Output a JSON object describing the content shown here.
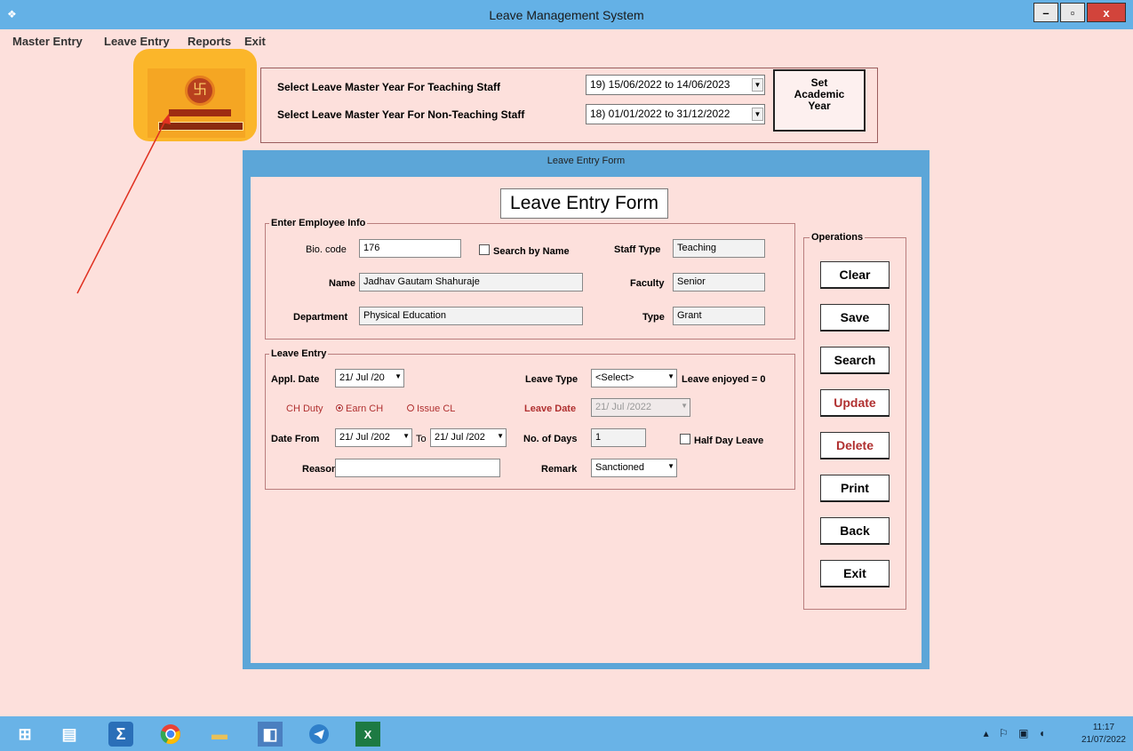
{
  "window": {
    "title": "Leave Management System"
  },
  "menu": [
    "Master Entry",
    "Leave Entry",
    "Reports",
    "Exit"
  ],
  "year": {
    "teaching_label": "Select Leave Master Year For Teaching Staff",
    "teaching_value": "19) 15/06/2022 to 14/06/2023",
    "nonteaching_label": "Select Leave Master Year For Non-Teaching Staff",
    "nonteaching_value": "18) 01/01/2022 to 31/12/2022",
    "set_button": [
      "Set",
      "Academic",
      "Year"
    ]
  },
  "dialog": {
    "title": "Leave Entry Form",
    "heading": "Leave Entry Form"
  },
  "employee": {
    "legend": "Enter Employee Info",
    "bio_label": "Bio. code",
    "bio_value": "176",
    "search_by_name": "Search by Name",
    "name_label": "Name",
    "name_value": "Jadhav Gautam Shahuraje",
    "dept_label": "Department",
    "dept_value": "Physical Education",
    "staff_type_label": "Staff Type",
    "staff_type_value": "Teaching",
    "faculty_label": "Faculty",
    "faculty_value": "Senior",
    "type_label": "Type",
    "type_value": "Grant"
  },
  "leave": {
    "legend": "Leave Entry",
    "appl_date_label": "Appl. Date",
    "appl_date_value": "21/ Jul /20",
    "ch_duty_label": "CH Duty",
    "earn_ch": "Earn CH",
    "issue_cl": "Issue CL",
    "date_from_label": "Date From",
    "date_from_value": "21/ Jul /202",
    "to_label": "To",
    "to_value": "21/ Jul /202",
    "reason_label": "Reason",
    "reason_value": "",
    "leave_type_label": "Leave Type",
    "leave_type_value": "<Select>",
    "leave_enjoyed": "Leave enjoyed = 0",
    "leave_date_label": "Leave Date",
    "leave_date_value": "21/ Jul /2022",
    "days_label": "No. of Days",
    "days_value": "1",
    "half_day": "Half Day Leave",
    "remark_label": "Remark",
    "remark_value": "Sanctioned"
  },
  "operations": {
    "legend": "Operations",
    "buttons": [
      "Clear",
      "Save",
      "Search",
      "Update",
      "Delete",
      "Print",
      "Back",
      "Exit"
    ]
  },
  "taskbar": {
    "time": "11:17",
    "date": "21/07/2022"
  },
  "colors": {
    "titlebar": "#64b1e6",
    "background": "#fde0dc",
    "accent_red": "#b03030"
  }
}
